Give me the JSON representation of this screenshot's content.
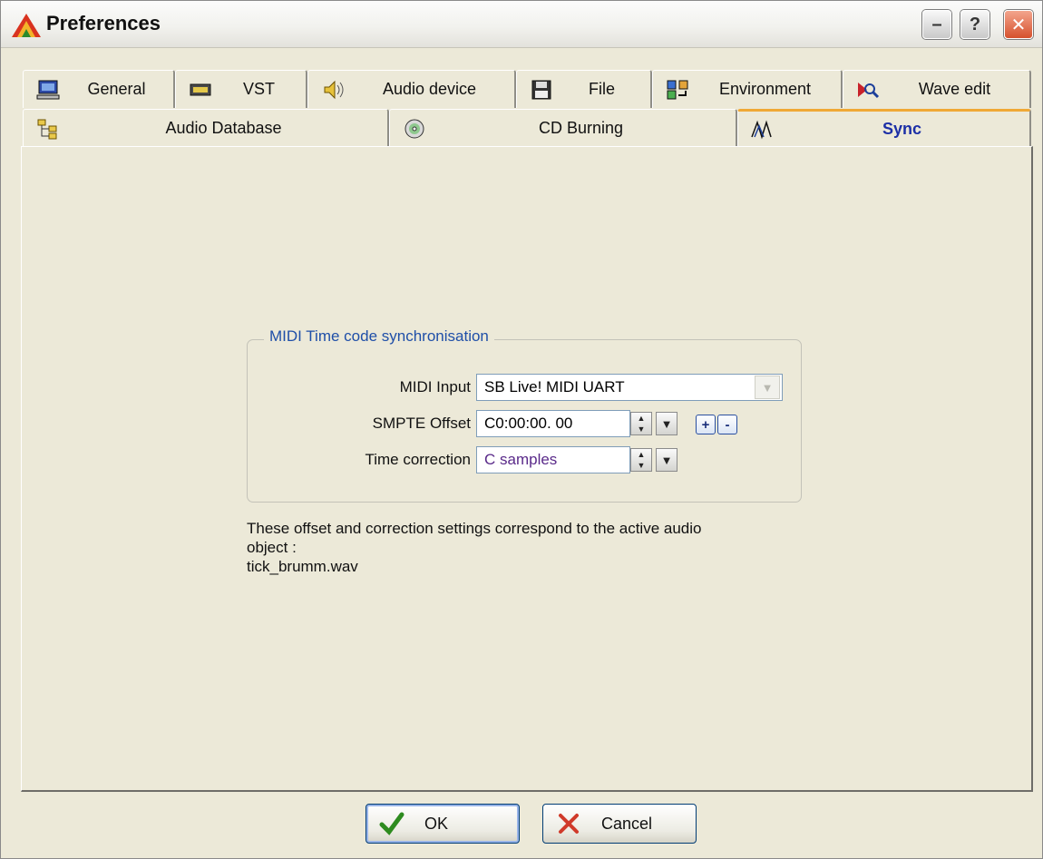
{
  "window": {
    "title": "Preferences"
  },
  "titlebar": {
    "minimize_label": "–",
    "help_label": "?",
    "close_label": "✕"
  },
  "tabs": {
    "row1": [
      {
        "label": "General",
        "icon": "computer-icon"
      },
      {
        "label": "VST",
        "icon": "vst-card-icon"
      },
      {
        "label": "Audio device",
        "icon": "speaker-icon"
      },
      {
        "label": "File",
        "icon": "floppy-disk-icon"
      },
      {
        "label": "Environment",
        "icon": "environment-arrows-icon"
      },
      {
        "label": "Wave edit",
        "icon": "wave-edit-icon"
      }
    ],
    "row2": [
      {
        "label": "Audio Database",
        "icon": "database-tree-icon"
      },
      {
        "label": "CD Burning",
        "icon": "cd-icon"
      },
      {
        "label": "Sync",
        "icon": "sync-wave-icon",
        "active": true
      }
    ]
  },
  "sync": {
    "group_title": "MIDI Time code synchronisation",
    "midi_input_label": "MIDI Input",
    "midi_input_value": "SB Live! MIDI UART",
    "smpte_offset_label": "SMPTE Offset",
    "smpte_offset_value": "C0:00:00. 00",
    "time_correction_label": "Time correction",
    "time_correction_value": "C samples",
    "plus_label": "+",
    "minus_label": "-",
    "info_line1": "These offset and correction settings correspond to the active audio",
    "info_line2": "object :",
    "info_file": "tick_brumm.wav"
  },
  "buttons": {
    "ok_label": "OK",
    "cancel_label": "Cancel"
  },
  "colors": {
    "window_bg": "#ece9d8",
    "active_tab_text": "#1c2fa6",
    "active_tab_accent": "#f0a835",
    "group_title": "#1f4fa8",
    "close_button": "#d6512d",
    "ok_check": "#2e8b1f",
    "cancel_x": "#d03a2a"
  }
}
